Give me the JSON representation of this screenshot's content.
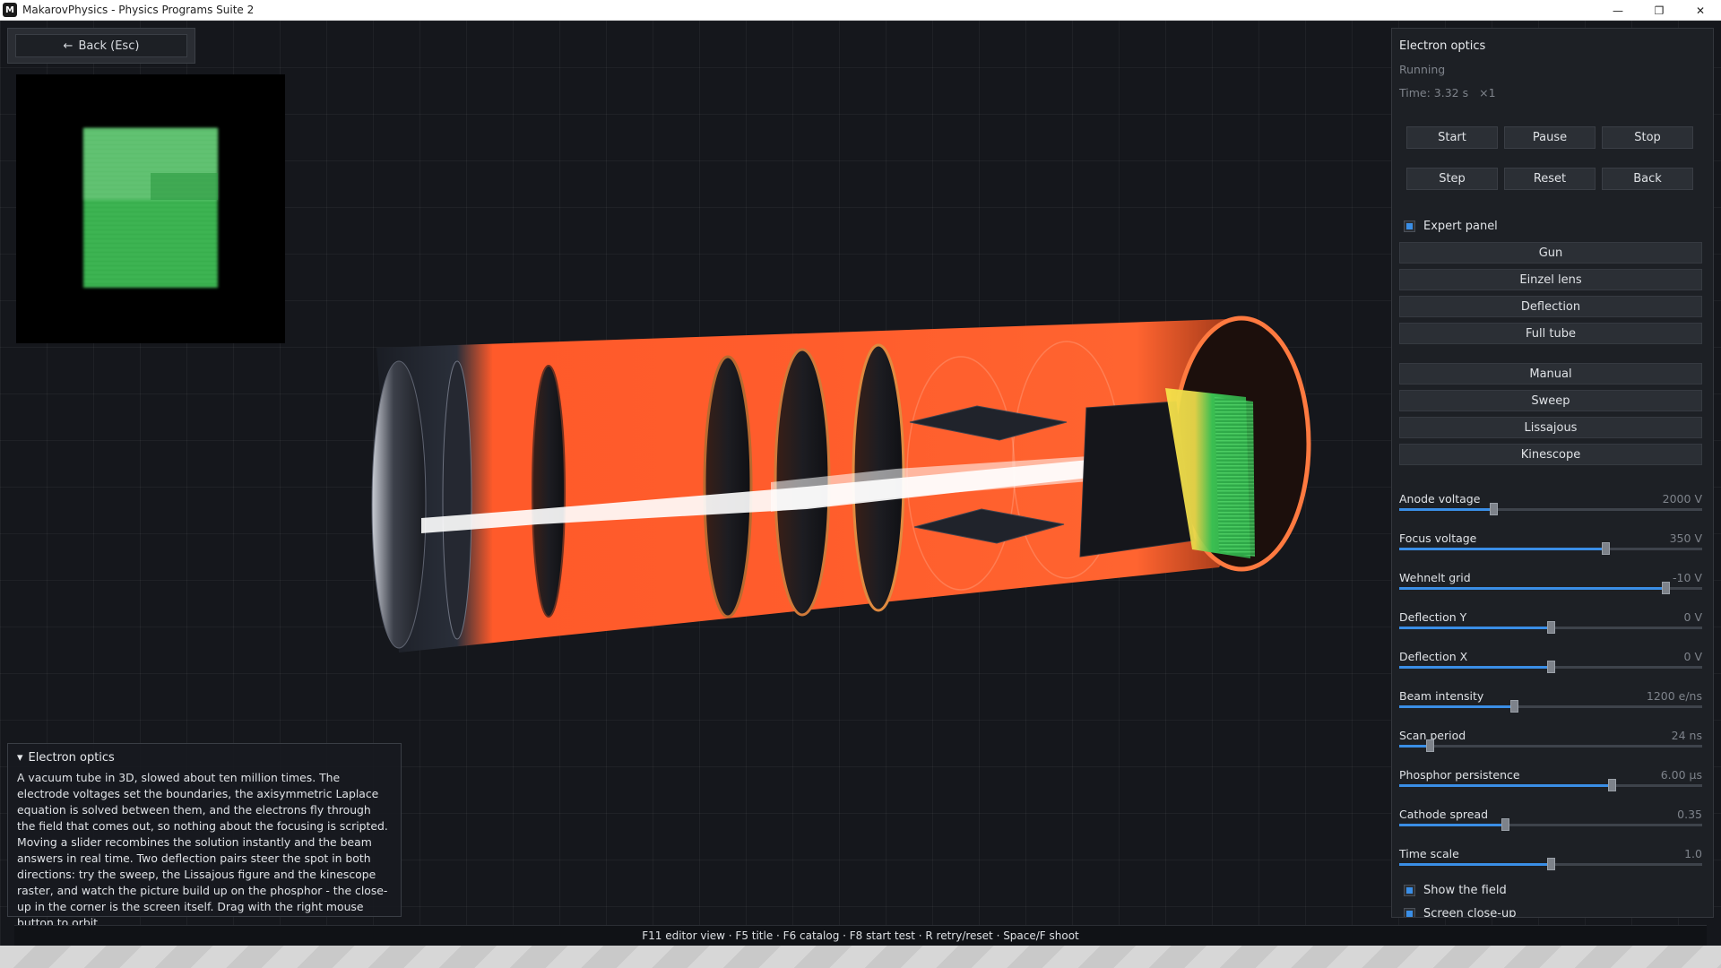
{
  "window": {
    "title": "MakarovPhysics - Physics Programs Suite 2",
    "icon_letter": "M",
    "minimize": "—",
    "restore": "❐",
    "close": "✕"
  },
  "back": {
    "arrow": "←",
    "label": "Back  (Esc)"
  },
  "info": {
    "toggle": "▾",
    "title": "Electron optics",
    "text": "A vacuum tube in 3D, slowed about ten million times. The electrode voltages set the boundaries, the axisymmetric Laplace equation is solved between them, and the electrons fly through the field that comes out, so nothing about the focusing is scripted. Moving a slider recombines the solution instantly and the beam answers in real time. Two deflection pairs steer the spot in both directions: try the sweep, the Lissajous figure and the kinescope raster, and watch the picture build up on the phosphor - the close-up in the corner is the screen itself. Drag with the right mouse button to orbit."
  },
  "hints": "F11 editor view · F5 title · F6 catalog · F8 start test · R retry/reset · Space/F shoot",
  "panel": {
    "title": "Electron optics",
    "status": "Running",
    "time": "Time: 3.32 s",
    "speed": "×1",
    "controls_row1": [
      "Start",
      "Pause",
      "Stop"
    ],
    "controls_row2": [
      "Step",
      "Reset",
      "Back"
    ],
    "expert_label": "Expert panel",
    "views": [
      "Gun",
      "Einzel lens",
      "Deflection",
      "Full tube"
    ],
    "modes": [
      "Manual",
      "Sweep",
      "Lissajous",
      "Kinescope"
    ],
    "sliders": [
      {
        "label": "Anode voltage",
        "value": "2000  V",
        "level": 0.31
      },
      {
        "label": "Focus voltage",
        "value": "350  V",
        "level": 0.68
      },
      {
        "label": "Wehnelt grid",
        "value": "-10  V",
        "level": 0.88
      },
      {
        "label": "Deflection Y",
        "value": "0  V",
        "level": 0.5
      },
      {
        "label": "Deflection X",
        "value": "0  V",
        "level": 0.5
      },
      {
        "label": "Beam intensity",
        "value": "1200  e/ns",
        "level": 0.38
      },
      {
        "label": "Scan period",
        "value": "24  ns",
        "level": 0.1
      },
      {
        "label": "Phosphor persistence",
        "value": "6.00  μs",
        "level": 0.7
      },
      {
        "label": "Cathode spread",
        "value": "0.35",
        "level": 0.35
      },
      {
        "label": "Time scale",
        "value": "1.0",
        "level": 0.5
      }
    ],
    "show_field_label": "Show the field",
    "screen_closeup_label": "Screen close-up"
  },
  "colors": {
    "accent": "#3a8ee6",
    "tube_glass": "#ff5a2a",
    "phosphor": "#2fc24a",
    "beam": "#ffffff"
  }
}
